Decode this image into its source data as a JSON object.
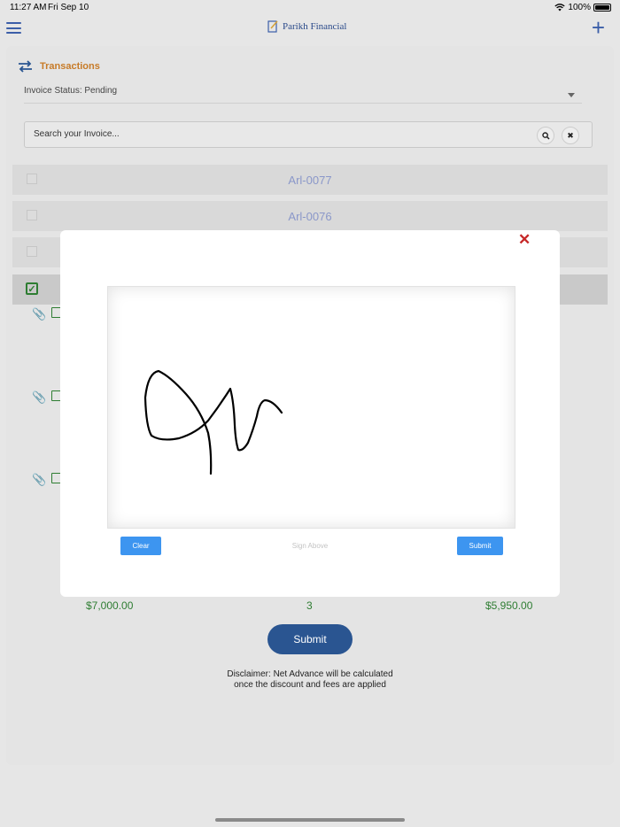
{
  "status_bar": {
    "time": "11:27 AM",
    "date": "Fri Sep 10",
    "battery": "100%"
  },
  "header": {
    "app_name": "Parikh Financial"
  },
  "transactions": {
    "title": "Transactions",
    "invoice_status": "Invoice Status: Pending",
    "search_placeholder": "Search your Invoice...",
    "invoices": [
      {
        "number": "Arl-0077"
      },
      {
        "number": "Arl-0076"
      }
    ]
  },
  "totals": {
    "amount": "$7,000.00",
    "count": "3",
    "net_advance": "$5,950.00"
  },
  "submit_label": "Submit",
  "disclaimer": "Disclaimer: Net Advance will be calculated\n once the discount  and fees  are applied",
  "signature_modal": {
    "clear_label": "Clear",
    "hint": "Sign Above",
    "submit_label": "Submit"
  },
  "colors": {
    "accent_orange": "#c77b28",
    "primary_blue": "#2a5591",
    "button_blue": "#3d95f0",
    "success_green": "#2e7d32",
    "close_red": "#c62828"
  }
}
